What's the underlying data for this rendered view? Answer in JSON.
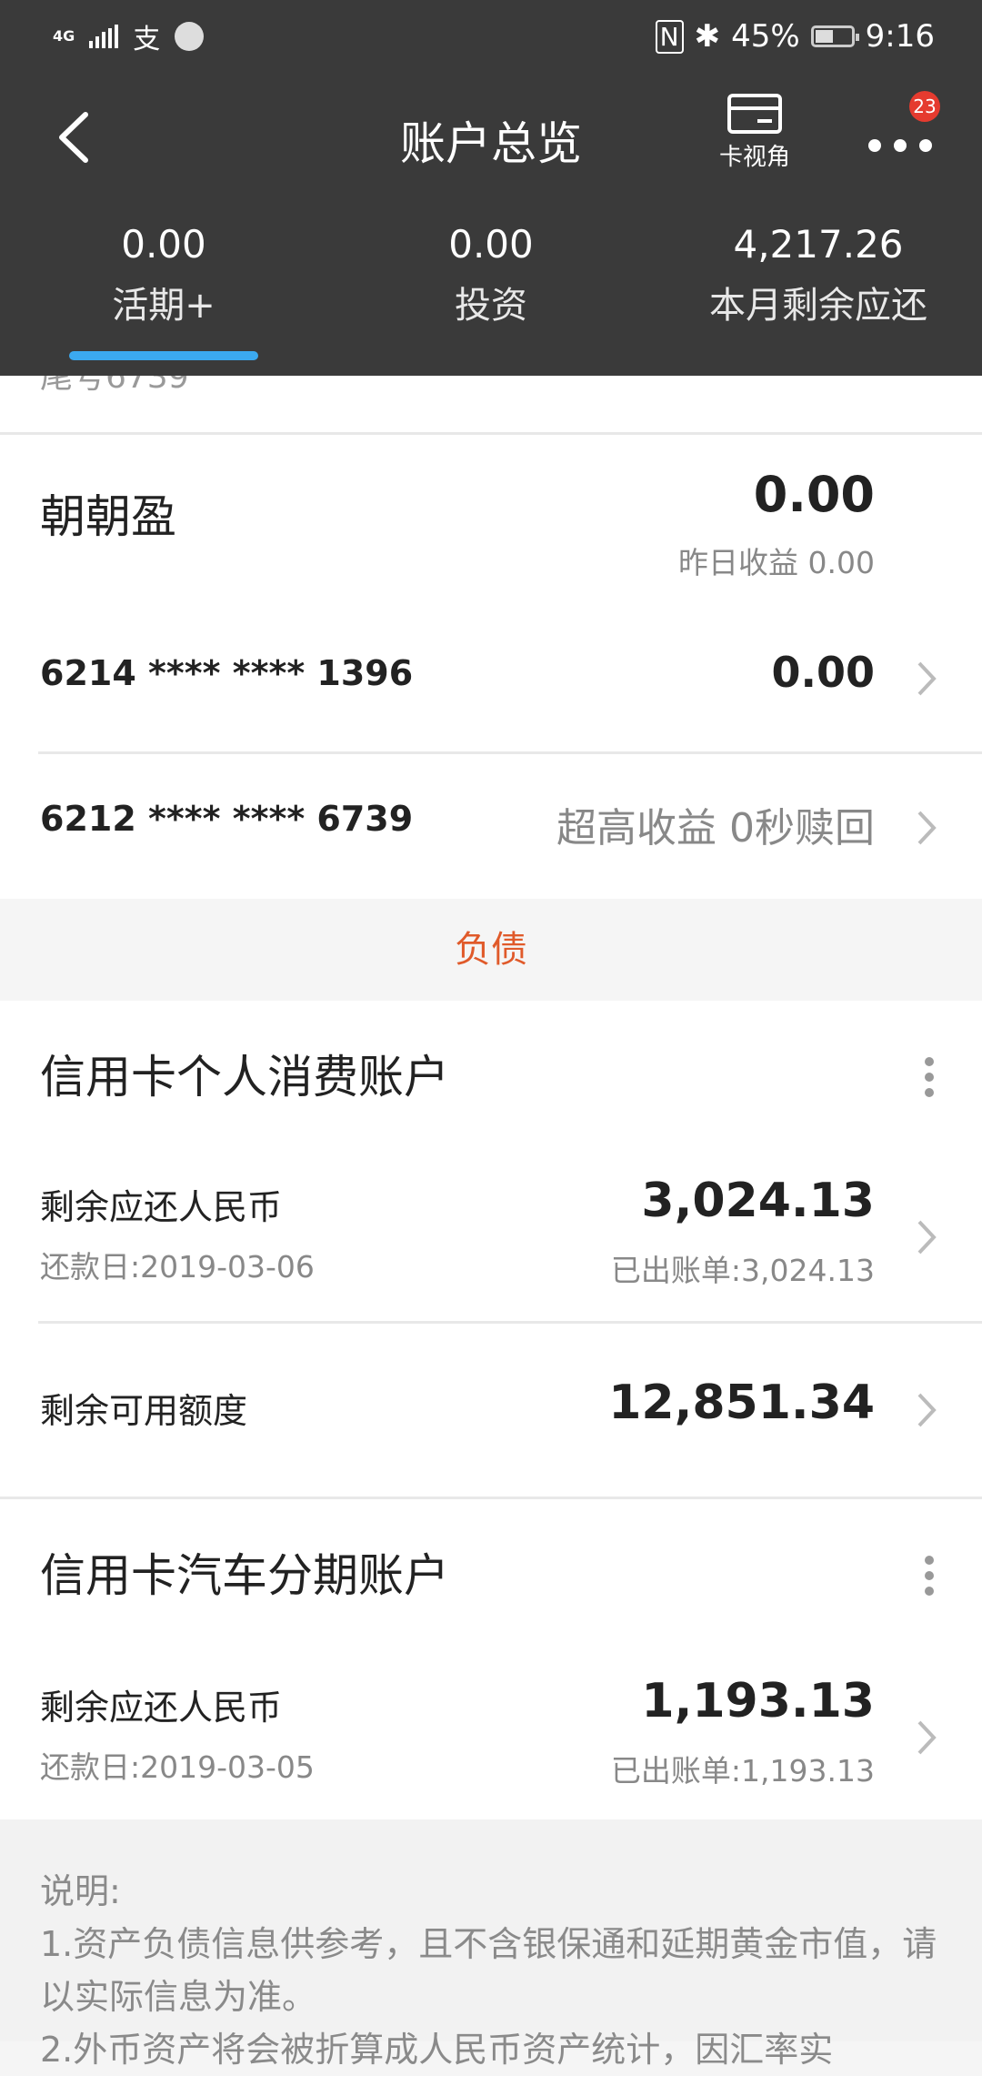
{
  "status_bar": {
    "network": "4G",
    "alipay_glyph": "支",
    "battery": "45%",
    "time": "9:16"
  },
  "nav": {
    "title": "账户总览",
    "card_view_label": "卡视角",
    "badge_count": "23"
  },
  "tabs": [
    {
      "value": "0.00",
      "label": "活期+"
    },
    {
      "value": "0.00",
      "label": "投资"
    },
    {
      "value": "4,217.26",
      "label": "本月剩余应还"
    }
  ],
  "partial_row_text": "尾号6739",
  "zhaozhaoying": {
    "title": "朝朝盈",
    "amount": "0.00",
    "yesterday_income": "昨日收益 0.00"
  },
  "cards": [
    {
      "number": "6214 **** **** 1396",
      "value": "0.00"
    },
    {
      "number": "6212 **** **** 6739",
      "promo": "超高收益 0秒赎回"
    }
  ],
  "liability_header": "负债",
  "credit_personal": {
    "title": "信用卡个人消费账户",
    "remaining_label": "剩余应还人民币",
    "due_date": "还款日:2019-03-06",
    "remaining_amount": "3,024.13",
    "billed": "已出账单:3,024.13",
    "available_label": "剩余可用额度",
    "available_amount": "12,851.34"
  },
  "credit_auto": {
    "title": "信用卡汽车分期账户",
    "remaining_label": "剩余应还人民币",
    "due_date": "还款日:2019-03-05",
    "remaining_amount": "1,193.13",
    "billed": "已出账单:1,193.13"
  },
  "notes": {
    "heading": "说明:",
    "line1": "1.资产负债信息供参考，且不含银保通和延期黄金市值，请以实际信息为准。",
    "line2": "2.外币资产将会被折算成人民币资产统计，因汇率实"
  },
  "colors": {
    "header_bg": "#3a3a3a",
    "tab_indicator": "#3ba9f0",
    "badge": "#e53b2f",
    "liability_accent": "#e05a2a"
  }
}
